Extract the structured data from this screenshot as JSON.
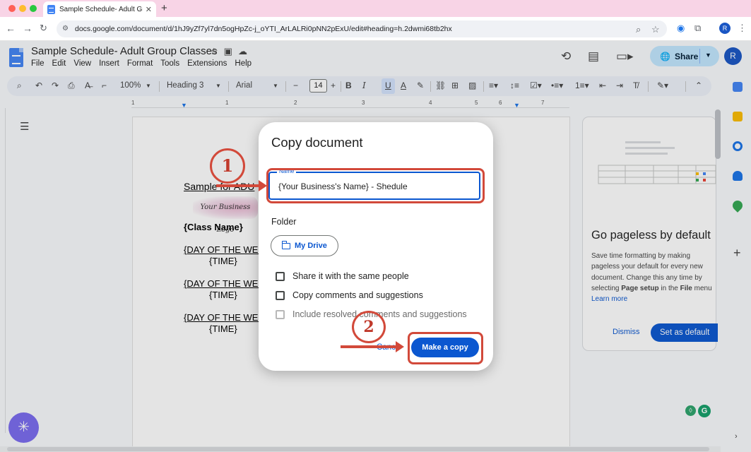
{
  "browser": {
    "tab_title": "Sample Schedule- Adult Grou",
    "close_glyph": "✕",
    "new_tab_glyph": "+",
    "url": "docs.google.com/document/d/1hJ9yZf7yl7dn5ogHpZc-j_oYTI_ArLALRi0pNN2pExU/edit#heading=h.2dwmi68tb2hx",
    "profile_initial": "R"
  },
  "doc": {
    "title": "Sample Schedule- Adult Group Classes",
    "menu": [
      "File",
      "Edit",
      "View",
      "Insert",
      "Format",
      "Tools",
      "Extensions",
      "Help"
    ],
    "share_label": "Share",
    "account_initial": "R"
  },
  "format_toolbar": {
    "zoom": "100%",
    "style": "Heading 3",
    "font": "Arial",
    "font_size": "14"
  },
  "ruler_numbers": [
    "1",
    "1",
    "2",
    "3",
    "4",
    "5",
    "6",
    "7"
  ],
  "document_body": {
    "heading": "Sample for ADU",
    "logo_text": "Your Business Logo",
    "class_name": "{Class Name}",
    "entries": [
      {
        "day": "{DAY OF THE WEE",
        "time": "{TIME}"
      },
      {
        "day": "{DAY OF THE WEE",
        "time": "{TIME}"
      },
      {
        "day": "{DAY OF THE WEE",
        "time": "{TIME}"
      }
    ]
  },
  "side_panel": {
    "heading": "Go pageless by default",
    "body_1": "Save time formatting by making pageless your default for every new document. Change this any time by selecting ",
    "body_bold_1": "Page setup",
    "body_2": " in the ",
    "body_bold_2": "File",
    "body_3": " menu",
    "link": "Learn more",
    "dismiss_label": "Dismiss",
    "set_default_label": "Set as default"
  },
  "dialog": {
    "title": "Copy document",
    "name_label": "Name",
    "name_value": "{Your Business's Name} - Shedule",
    "folder_label": "Folder",
    "folder_button": "My Drive",
    "checkboxes": [
      {
        "label": "Share it with the same people",
        "checked": false,
        "enabled": true
      },
      {
        "label": "Copy comments and suggestions",
        "checked": false,
        "enabled": true
      },
      {
        "label": "Include resolved comments and suggestions",
        "checked": false,
        "enabled": false
      }
    ],
    "cancel_label": "Canc",
    "confirm_label": "Make a copy"
  },
  "annotations": {
    "step_1": "1",
    "step_2": "2",
    "color": "#d2493a"
  },
  "colors": {
    "primary": "#0b57d0",
    "share_bg": "#c2e7ff",
    "tabstrip_bg": "#f8d4e6"
  }
}
